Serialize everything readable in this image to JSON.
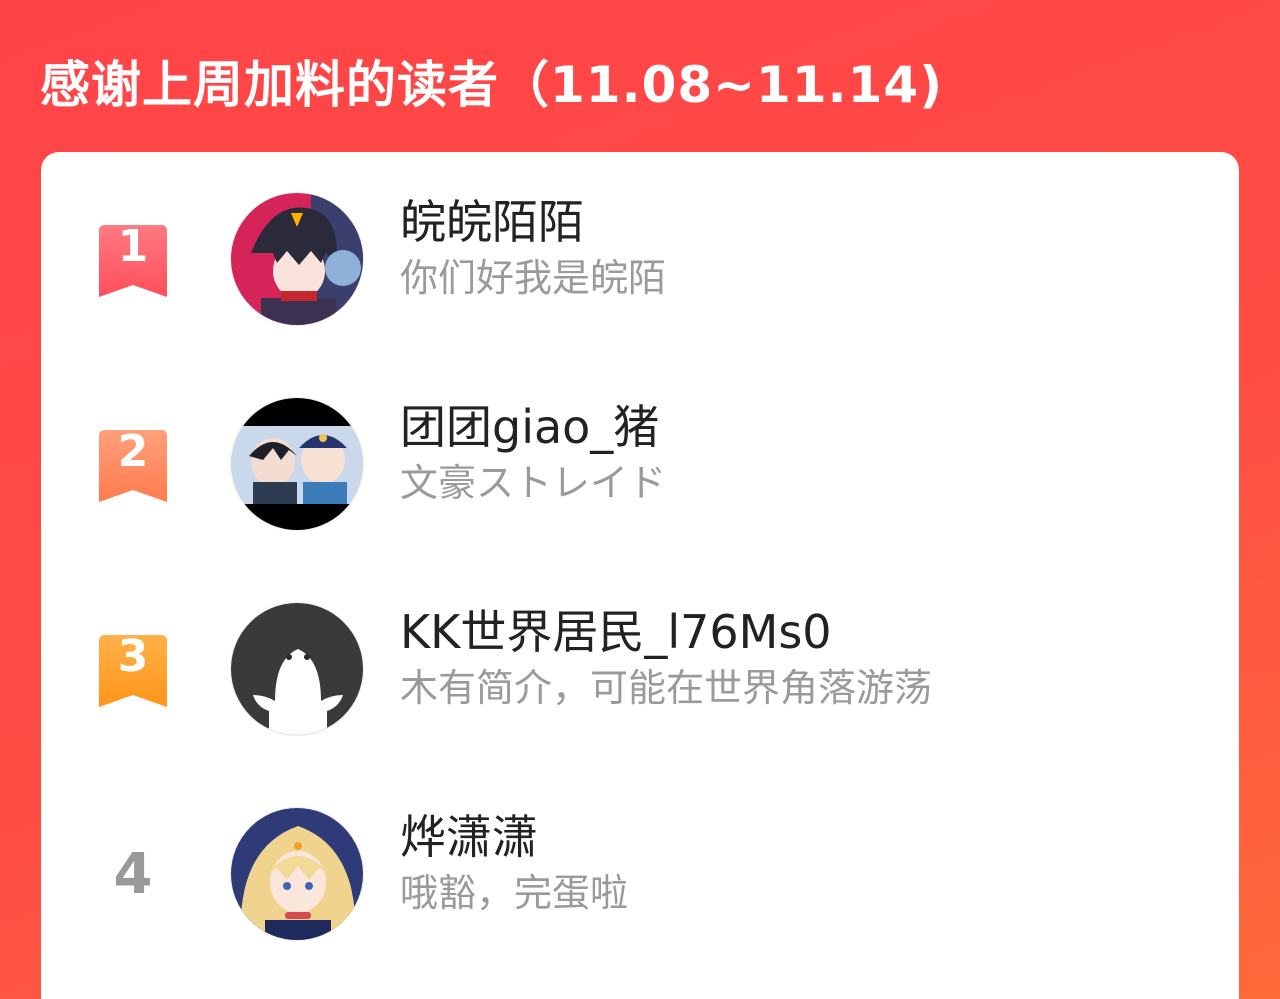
{
  "header": {
    "title": "感谢上周加料的读者（11.08~11.14)"
  },
  "readers": [
    {
      "rank": "1",
      "name": "皖皖陌陌",
      "bio": "你们好我是皖陌",
      "badge_color_top": "#ff6f78",
      "badge_color_bottom": "#ff4b57",
      "avatar": "anime-avatar-dark-hair"
    },
    {
      "rank": "2",
      "name": "团团giao_猪",
      "bio": "文豪ストレイド",
      "badge_color_top": "#ff9b6b",
      "badge_color_bottom": "#ff7a4d",
      "avatar": "anime-avatar-two-boys"
    },
    {
      "rank": "3",
      "name": "KK世界居民_l76Ms0",
      "bio": "木有简介，可能在世界角落游荡",
      "badge_color_top": "#ffb24a",
      "badge_color_bottom": "#ff9418",
      "avatar": "default-ghost-avatar"
    },
    {
      "rank": "4",
      "name": "烨潇潇",
      "bio": "哦豁，完蛋啦",
      "avatar": "anime-avatar-blonde-girl"
    }
  ]
}
